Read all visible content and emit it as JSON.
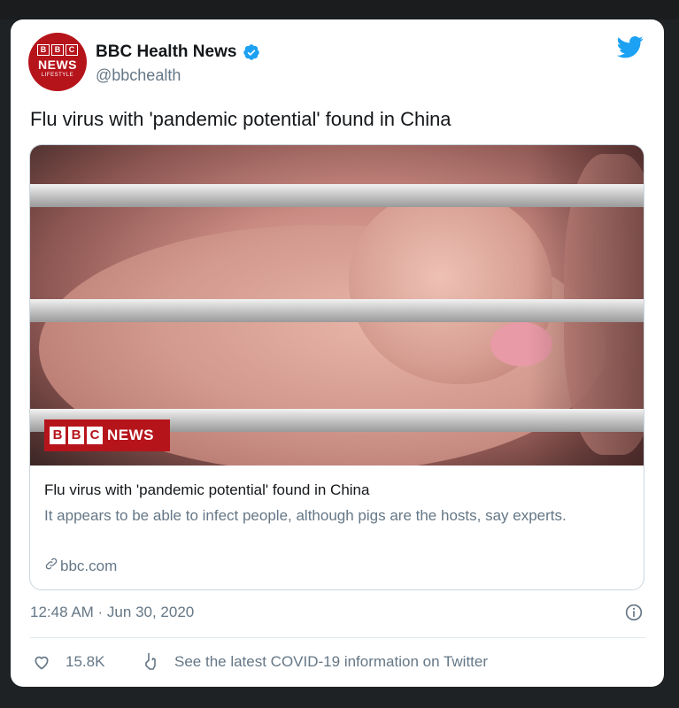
{
  "account": {
    "name": "BBC Health News",
    "handle": "@bbchealth",
    "avatar": {
      "blocks": [
        "B",
        "B",
        "C"
      ],
      "news": "NEWS",
      "lifestyle": "LIFESTYLE"
    }
  },
  "tweet": {
    "text": "Flu virus with 'pandemic potential' found in China",
    "timestamp": "12:48 AM · Jun 30, 2020",
    "likes": "15.8K",
    "covid_link": "See the latest COVID-19 information on Twitter"
  },
  "link_card": {
    "title": "Flu virus with 'pandemic potential' found in China",
    "description": "It appears to be able to infect people, although pigs are the hosts, say experts.",
    "domain": "bbc.com",
    "logo": {
      "blocks": [
        "B",
        "B",
        "C"
      ],
      "news": "NEWS"
    }
  },
  "colors": {
    "twitter_blue": "#1da1f2",
    "bbc_red": "#b6141b",
    "text_primary": "#14171a",
    "text_secondary": "#657786"
  },
  "icons": [
    "verified-badge-icon",
    "twitter-bird-icon",
    "link-chain-icon",
    "info-icon",
    "heart-icon",
    "covid-info-icon"
  ]
}
